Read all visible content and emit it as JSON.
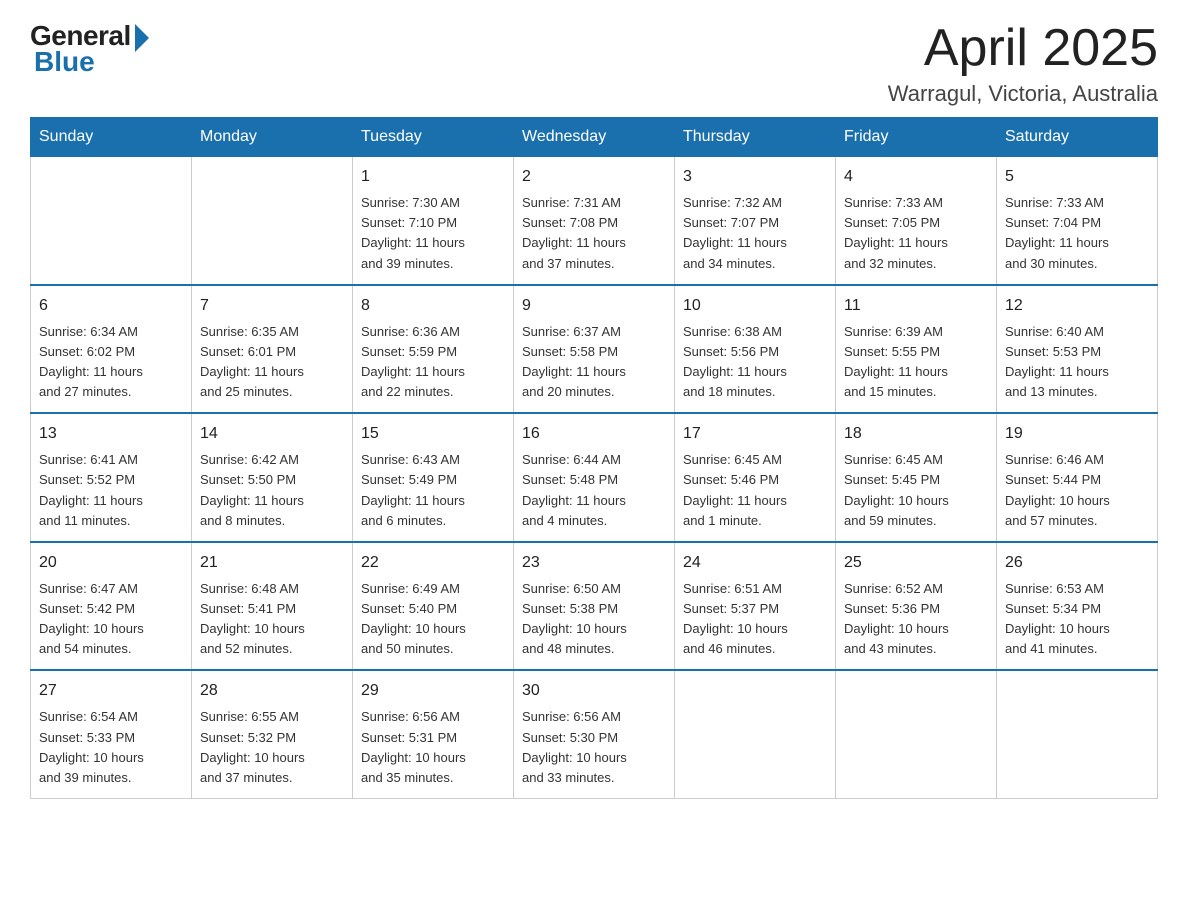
{
  "header": {
    "logo_general": "General",
    "logo_blue": "Blue",
    "title": "April 2025",
    "location": "Warragul, Victoria, Australia"
  },
  "days_of_week": [
    "Sunday",
    "Monday",
    "Tuesday",
    "Wednesday",
    "Thursday",
    "Friday",
    "Saturday"
  ],
  "weeks": [
    [
      {
        "day": "",
        "info": ""
      },
      {
        "day": "",
        "info": ""
      },
      {
        "day": "1",
        "info": "Sunrise: 7:30 AM\nSunset: 7:10 PM\nDaylight: 11 hours\nand 39 minutes."
      },
      {
        "day": "2",
        "info": "Sunrise: 7:31 AM\nSunset: 7:08 PM\nDaylight: 11 hours\nand 37 minutes."
      },
      {
        "day": "3",
        "info": "Sunrise: 7:32 AM\nSunset: 7:07 PM\nDaylight: 11 hours\nand 34 minutes."
      },
      {
        "day": "4",
        "info": "Sunrise: 7:33 AM\nSunset: 7:05 PM\nDaylight: 11 hours\nand 32 minutes."
      },
      {
        "day": "5",
        "info": "Sunrise: 7:33 AM\nSunset: 7:04 PM\nDaylight: 11 hours\nand 30 minutes."
      }
    ],
    [
      {
        "day": "6",
        "info": "Sunrise: 6:34 AM\nSunset: 6:02 PM\nDaylight: 11 hours\nand 27 minutes."
      },
      {
        "day": "7",
        "info": "Sunrise: 6:35 AM\nSunset: 6:01 PM\nDaylight: 11 hours\nand 25 minutes."
      },
      {
        "day": "8",
        "info": "Sunrise: 6:36 AM\nSunset: 5:59 PM\nDaylight: 11 hours\nand 22 minutes."
      },
      {
        "day": "9",
        "info": "Sunrise: 6:37 AM\nSunset: 5:58 PM\nDaylight: 11 hours\nand 20 minutes."
      },
      {
        "day": "10",
        "info": "Sunrise: 6:38 AM\nSunset: 5:56 PM\nDaylight: 11 hours\nand 18 minutes."
      },
      {
        "day": "11",
        "info": "Sunrise: 6:39 AM\nSunset: 5:55 PM\nDaylight: 11 hours\nand 15 minutes."
      },
      {
        "day": "12",
        "info": "Sunrise: 6:40 AM\nSunset: 5:53 PM\nDaylight: 11 hours\nand 13 minutes."
      }
    ],
    [
      {
        "day": "13",
        "info": "Sunrise: 6:41 AM\nSunset: 5:52 PM\nDaylight: 11 hours\nand 11 minutes."
      },
      {
        "day": "14",
        "info": "Sunrise: 6:42 AM\nSunset: 5:50 PM\nDaylight: 11 hours\nand 8 minutes."
      },
      {
        "day": "15",
        "info": "Sunrise: 6:43 AM\nSunset: 5:49 PM\nDaylight: 11 hours\nand 6 minutes."
      },
      {
        "day": "16",
        "info": "Sunrise: 6:44 AM\nSunset: 5:48 PM\nDaylight: 11 hours\nand 4 minutes."
      },
      {
        "day": "17",
        "info": "Sunrise: 6:45 AM\nSunset: 5:46 PM\nDaylight: 11 hours\nand 1 minute."
      },
      {
        "day": "18",
        "info": "Sunrise: 6:45 AM\nSunset: 5:45 PM\nDaylight: 10 hours\nand 59 minutes."
      },
      {
        "day": "19",
        "info": "Sunrise: 6:46 AM\nSunset: 5:44 PM\nDaylight: 10 hours\nand 57 minutes."
      }
    ],
    [
      {
        "day": "20",
        "info": "Sunrise: 6:47 AM\nSunset: 5:42 PM\nDaylight: 10 hours\nand 54 minutes."
      },
      {
        "day": "21",
        "info": "Sunrise: 6:48 AM\nSunset: 5:41 PM\nDaylight: 10 hours\nand 52 minutes."
      },
      {
        "day": "22",
        "info": "Sunrise: 6:49 AM\nSunset: 5:40 PM\nDaylight: 10 hours\nand 50 minutes."
      },
      {
        "day": "23",
        "info": "Sunrise: 6:50 AM\nSunset: 5:38 PM\nDaylight: 10 hours\nand 48 minutes."
      },
      {
        "day": "24",
        "info": "Sunrise: 6:51 AM\nSunset: 5:37 PM\nDaylight: 10 hours\nand 46 minutes."
      },
      {
        "day": "25",
        "info": "Sunrise: 6:52 AM\nSunset: 5:36 PM\nDaylight: 10 hours\nand 43 minutes."
      },
      {
        "day": "26",
        "info": "Sunrise: 6:53 AM\nSunset: 5:34 PM\nDaylight: 10 hours\nand 41 minutes."
      }
    ],
    [
      {
        "day": "27",
        "info": "Sunrise: 6:54 AM\nSunset: 5:33 PM\nDaylight: 10 hours\nand 39 minutes."
      },
      {
        "day": "28",
        "info": "Sunrise: 6:55 AM\nSunset: 5:32 PM\nDaylight: 10 hours\nand 37 minutes."
      },
      {
        "day": "29",
        "info": "Sunrise: 6:56 AM\nSunset: 5:31 PM\nDaylight: 10 hours\nand 35 minutes."
      },
      {
        "day": "30",
        "info": "Sunrise: 6:56 AM\nSunset: 5:30 PM\nDaylight: 10 hours\nand 33 minutes."
      },
      {
        "day": "",
        "info": ""
      },
      {
        "day": "",
        "info": ""
      },
      {
        "day": "",
        "info": ""
      }
    ]
  ]
}
